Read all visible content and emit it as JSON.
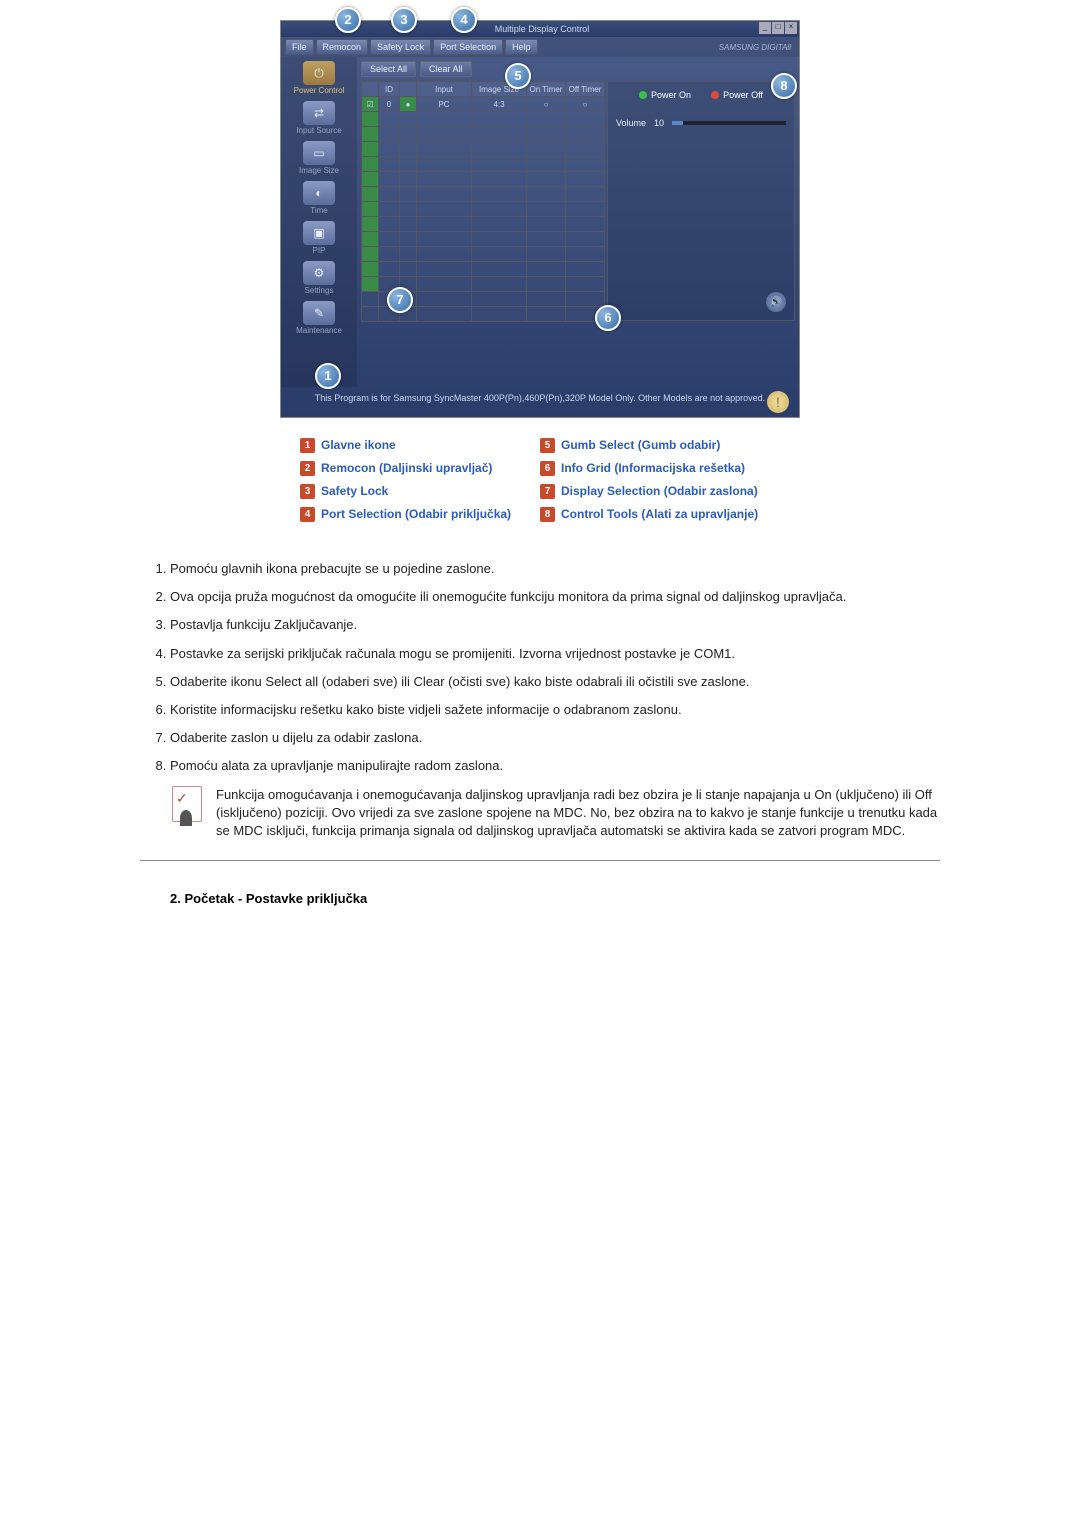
{
  "app": {
    "title": "Multiple Display Control",
    "brand": "SAMSUNG DIGITAll"
  },
  "menu": {
    "file": "File",
    "remocon": "Remocon",
    "safety_lock": "Safety Lock",
    "port_selection": "Port Selection",
    "help": "Help"
  },
  "sidebar": {
    "items": [
      {
        "label": "Power Control",
        "icon": "⏻"
      },
      {
        "label": "Input Source",
        "icon": "⇄"
      },
      {
        "label": "Image Size",
        "icon": "▭"
      },
      {
        "label": "Time",
        "icon": "◐"
      },
      {
        "label": "PIP",
        "icon": "▣"
      },
      {
        "label": "Settings",
        "icon": "⚙"
      },
      {
        "label": "Maintenance",
        "icon": "✎"
      }
    ]
  },
  "buttons": {
    "select_all": "Select All",
    "clear_all": "Clear All",
    "power_on": "Power On",
    "power_off": "Power Off"
  },
  "grid": {
    "headers": [
      "",
      "ID",
      "",
      "Input",
      "Image Size",
      "On Timer",
      "Off Timer"
    ],
    "row1": {
      "id": "0",
      "input": "PC",
      "size": "4:3"
    }
  },
  "controls": {
    "volume_label": "Volume",
    "volume_value": "10"
  },
  "footer": {
    "msg": "This Program is for Samsung SyncMaster 400P(Pn),460P(Pn),320P Model Only. Other Models are not approved."
  },
  "legend": {
    "1": "Glavne ikone",
    "2": "Remocon (Daljinski upravljač)",
    "3": "Safety Lock",
    "4": "Port Selection (Odabir priključka)",
    "5": "Gumb Select (Gumb odabir)",
    "6": "Info Grid (Informacijska rešetka)",
    "7": "Display Selection (Odabir zaslona)",
    "8": "Control Tools (Alati za upravljanje)"
  },
  "list": {
    "1": "Pomoću glavnih ikona prebacujte se u pojedine zaslone.",
    "2": "Ova opcija pruža mogućnost da omogućite ili onemogućite funkciju monitora da prima signal od daljinskog upravljača.",
    "3": "Postavlja funkciju Zaključavanje.",
    "4": "Postavke za serijski priključak računala mogu se promijeniti. Izvorna vrijednost postavke je COM1.",
    "5": "Odaberite ikonu Select all (odaberi sve) ili Clear (očisti sve) kako biste odabrali ili očistili sve zaslone.",
    "6": "Koristite informacijsku rešetku kako biste vidjeli sažete informacije o odabranom zaslonu.",
    "7": "Odaberite zaslon u dijelu za odabir zaslona.",
    "8": "Pomoću alata za upravljanje manipulirajte radom zaslona."
  },
  "note": "Funkcija omogućavanja i onemogućavanja daljinskog upravljanja radi bez obzira je li stanje napajanja u On (uključeno) ili Off (isključeno) poziciji. Ovo vrijedi za sve zaslone spojene na MDC. No, bez obzira na to kakvo je stanje funkcije u trenutku kada se MDC isključi, funkcija primanja signala od daljinskog upravljača automatski se aktivira kada se zatvori program MDC.",
  "heading2": "2. Početak - Postavke priključka"
}
